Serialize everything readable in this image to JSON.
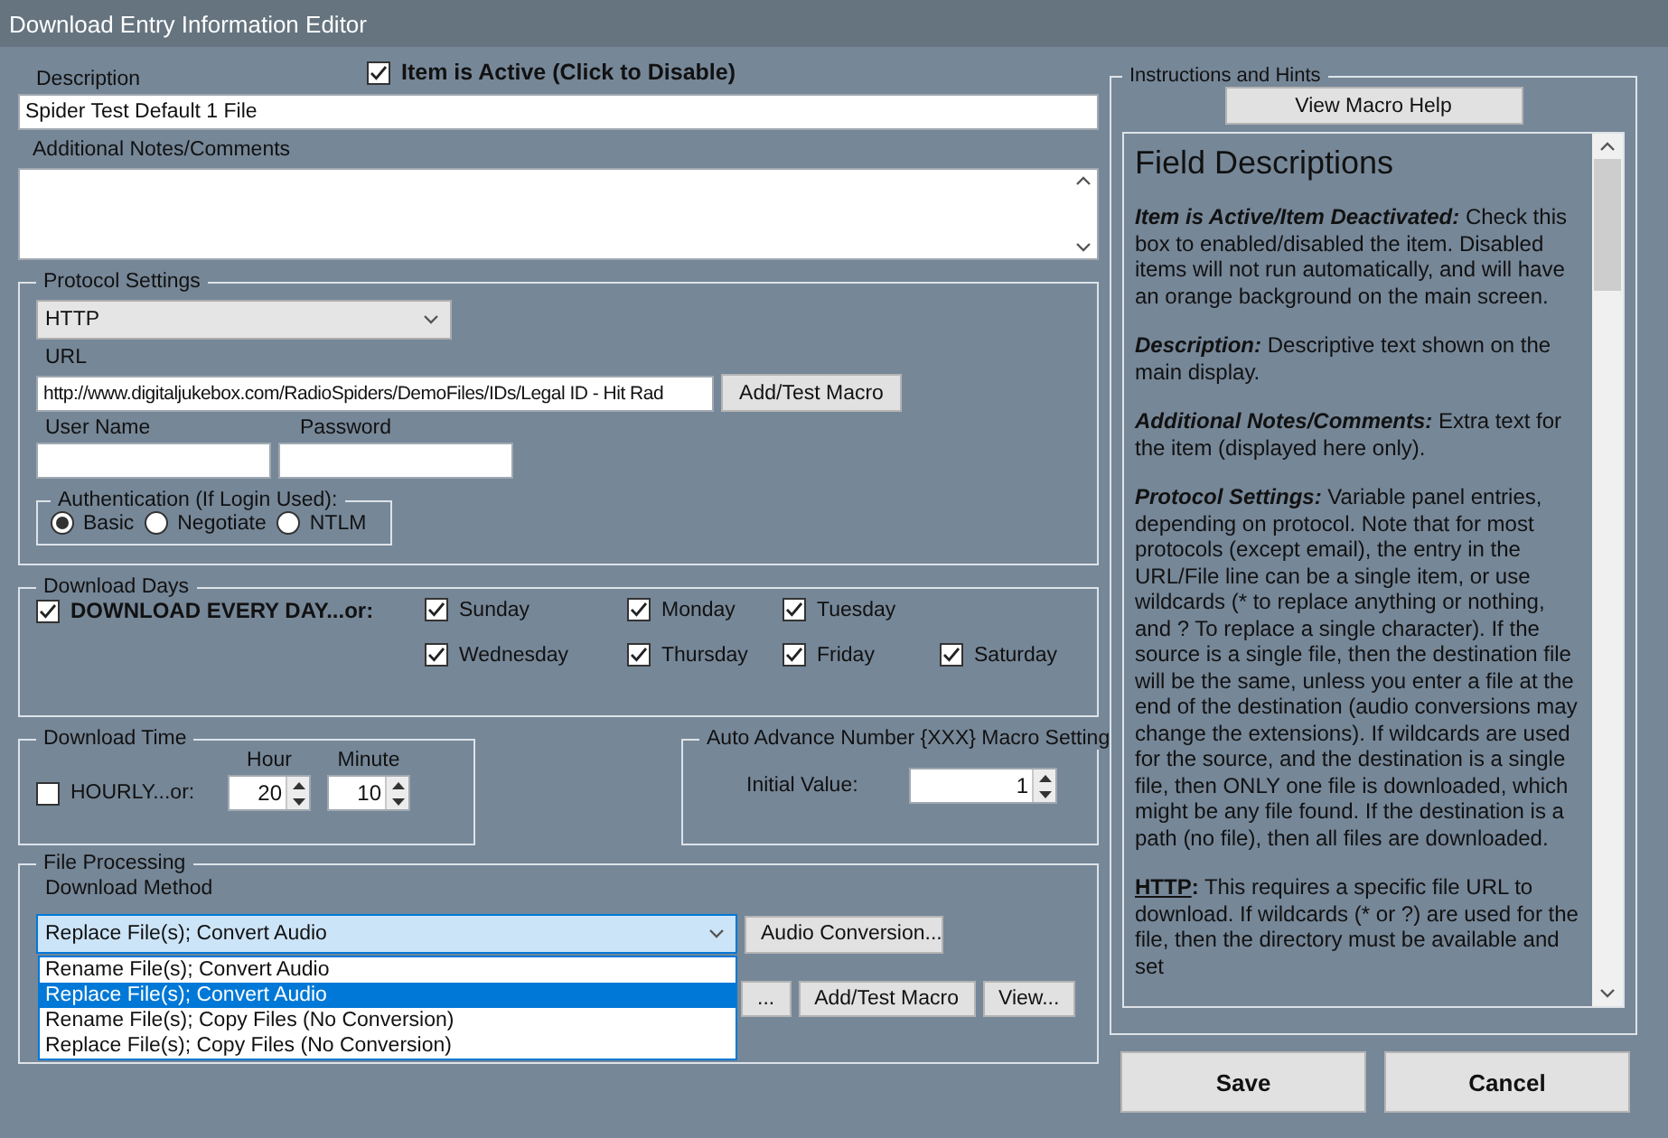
{
  "window": {
    "title": "Download Entry Information Editor"
  },
  "description": {
    "label": "Description",
    "value": "Spider Test Default 1 File"
  },
  "active": {
    "label": "Item is Active (Click to Disable)",
    "checked": true
  },
  "notes": {
    "label": "Additional Notes/Comments"
  },
  "protocol": {
    "legend": "Protocol Settings",
    "select": {
      "value": "HTTP"
    },
    "url": {
      "label": "URL",
      "value": "http://www.digitaljukebox.com/RadioSpiders/DemoFiles/IDs/Legal ID - Hit Rad"
    },
    "macro_button": "Add/Test Macro",
    "username": {
      "label": "User Name"
    },
    "password": {
      "label": "Password"
    },
    "auth": {
      "legend": "Authentication (If Login Used):",
      "options": [
        {
          "label": "Basic",
          "selected": true
        },
        {
          "label": "Negotiate",
          "selected": false
        },
        {
          "label": "NTLM",
          "selected": false
        }
      ]
    }
  },
  "download_days": {
    "legend": "Download Days",
    "every_day": {
      "label": "DOWNLOAD EVERY DAY...or:",
      "checked": true
    },
    "days": [
      {
        "label": "Sunday",
        "checked": true
      },
      {
        "label": "Monday",
        "checked": true
      },
      {
        "label": "Tuesday",
        "checked": true
      },
      {
        "label": "Wednesday",
        "checked": true
      },
      {
        "label": "Thursday",
        "checked": true
      },
      {
        "label": "Friday",
        "checked": true
      },
      {
        "label": "Saturday",
        "checked": true
      }
    ]
  },
  "download_time": {
    "legend": "Download Time",
    "hourly": {
      "label": "HOURLY...or:",
      "checked": false
    },
    "hour": {
      "label": "Hour",
      "value": "20"
    },
    "minute": {
      "label": "Minute",
      "value": "10"
    }
  },
  "auto_advance": {
    "legend": "Auto Advance Number {XXX} Macro Setting",
    "initial_value": {
      "label": "Initial Value:",
      "value": "1"
    }
  },
  "file_processing": {
    "legend": "File Processing",
    "method_label": "Download Method",
    "method_select": {
      "value": "Replace File(s); Convert Audio",
      "expanded": true,
      "options": [
        {
          "label": "Rename File(s); Convert Audio",
          "selected": false
        },
        {
          "label": "Replace File(s); Convert Audio",
          "selected": true
        },
        {
          "label": "Rename File(s); Copy Files (No Conversion)",
          "selected": false
        },
        {
          "label": "Replace File(s); Copy Files (No Conversion)",
          "selected": false
        }
      ]
    },
    "audio_button": "Audio Conversion...",
    "buttons": [
      "...",
      "Add/Test Macro",
      "View..."
    ]
  },
  "instructions": {
    "legend": "Instructions and Hints",
    "help_button": "View Macro Help",
    "heading": "Field Descriptions",
    "paragraphs": [
      {
        "kind": "italic",
        "term": "Item is Active/Item Deactivated:",
        "text": " Check this box to enabled/disabled the item. Disabled items will not run automatically, and will have an orange background on the main screen."
      },
      {
        "kind": "italic",
        "term": "Description:",
        "text": " Descriptive text shown on the main display."
      },
      {
        "kind": "italic",
        "term": "Additional Notes/Comments:",
        "text": " Extra text for the item (displayed here only)."
      },
      {
        "kind": "italic",
        "term": "Protocol Settings:",
        "text": " Variable panel entries, depending on protocol. Note that for most protocols (except email), the entry in the URL/File line can be a single item, or use wildcards (* to replace anything or nothing, and ? To replace a single character). If the source is a single file, then the destination file will be the same, unless you enter a file at the end of the destination (audio conversions may change the extensions). If wildcards are used for the source, and the destination is a single file, then ONLY one file is downloaded, which might be any file found. If the destination is a path (no file), then all files are downloaded."
      },
      {
        "kind": "underline",
        "term": "HTTP",
        "text": "**:** This requires a specific file URL to download. If wildcards (* or ?) are used for the file, then the directory must be available and set"
      }
    ]
  },
  "buttons": [
    "Save",
    "Cancel"
  ]
}
